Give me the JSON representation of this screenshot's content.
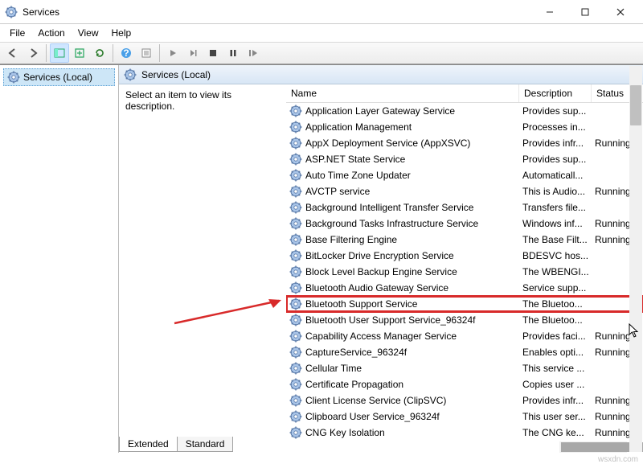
{
  "window": {
    "title": "Services",
    "minimize": "—",
    "maximize": "□",
    "close": "✕"
  },
  "menu": {
    "file": "File",
    "action": "Action",
    "view": "View",
    "help": "Help"
  },
  "tree": {
    "root": "Services (Local)"
  },
  "content": {
    "header": "Services (Local)",
    "instruction": "Select an item to view its description."
  },
  "columns": {
    "name": "Name",
    "description": "Description",
    "status": "Status"
  },
  "services": [
    {
      "name": "Application Layer Gateway Service",
      "desc": "Provides sup...",
      "status": ""
    },
    {
      "name": "Application Management",
      "desc": "Processes in...",
      "status": ""
    },
    {
      "name": "AppX Deployment Service (AppXSVC)",
      "desc": "Provides infr...",
      "status": "Running"
    },
    {
      "name": "ASP.NET State Service",
      "desc": "Provides sup...",
      "status": ""
    },
    {
      "name": "Auto Time Zone Updater",
      "desc": "Automaticall...",
      "status": ""
    },
    {
      "name": "AVCTP service",
      "desc": "This is Audio...",
      "status": "Running"
    },
    {
      "name": "Background Intelligent Transfer Service",
      "desc": "Transfers file...",
      "status": ""
    },
    {
      "name": "Background Tasks Infrastructure Service",
      "desc": "Windows inf...",
      "status": "Running"
    },
    {
      "name": "Base Filtering Engine",
      "desc": "The Base Filt...",
      "status": "Running"
    },
    {
      "name": "BitLocker Drive Encryption Service",
      "desc": "BDESVC hos...",
      "status": ""
    },
    {
      "name": "Block Level Backup Engine Service",
      "desc": "The WBENGI...",
      "status": ""
    },
    {
      "name": "Bluetooth Audio Gateway Service",
      "desc": "Service supp...",
      "status": ""
    },
    {
      "name": "Bluetooth Support Service",
      "desc": "The Bluetoo...",
      "status": "",
      "hl": true
    },
    {
      "name": "Bluetooth User Support Service_96324f",
      "desc": "The Bluetoo...",
      "status": ""
    },
    {
      "name": "Capability Access Manager Service",
      "desc": "Provides faci...",
      "status": "Running"
    },
    {
      "name": "CaptureService_96324f",
      "desc": "Enables opti...",
      "status": "Running"
    },
    {
      "name": "Cellular Time",
      "desc": "This service ...",
      "status": ""
    },
    {
      "name": "Certificate Propagation",
      "desc": "Copies user ...",
      "status": ""
    },
    {
      "name": "Client License Service (ClipSVC)",
      "desc": "Provides infr...",
      "status": "Running"
    },
    {
      "name": "Clipboard User Service_96324f",
      "desc": "This user ser...",
      "status": "Running"
    },
    {
      "name": "CNG Key Isolation",
      "desc": "The CNG ke...",
      "status": "Running"
    }
  ],
  "tabs": {
    "extended": "Extended",
    "standard": "Standard"
  },
  "watermark": "wsxdn.com"
}
